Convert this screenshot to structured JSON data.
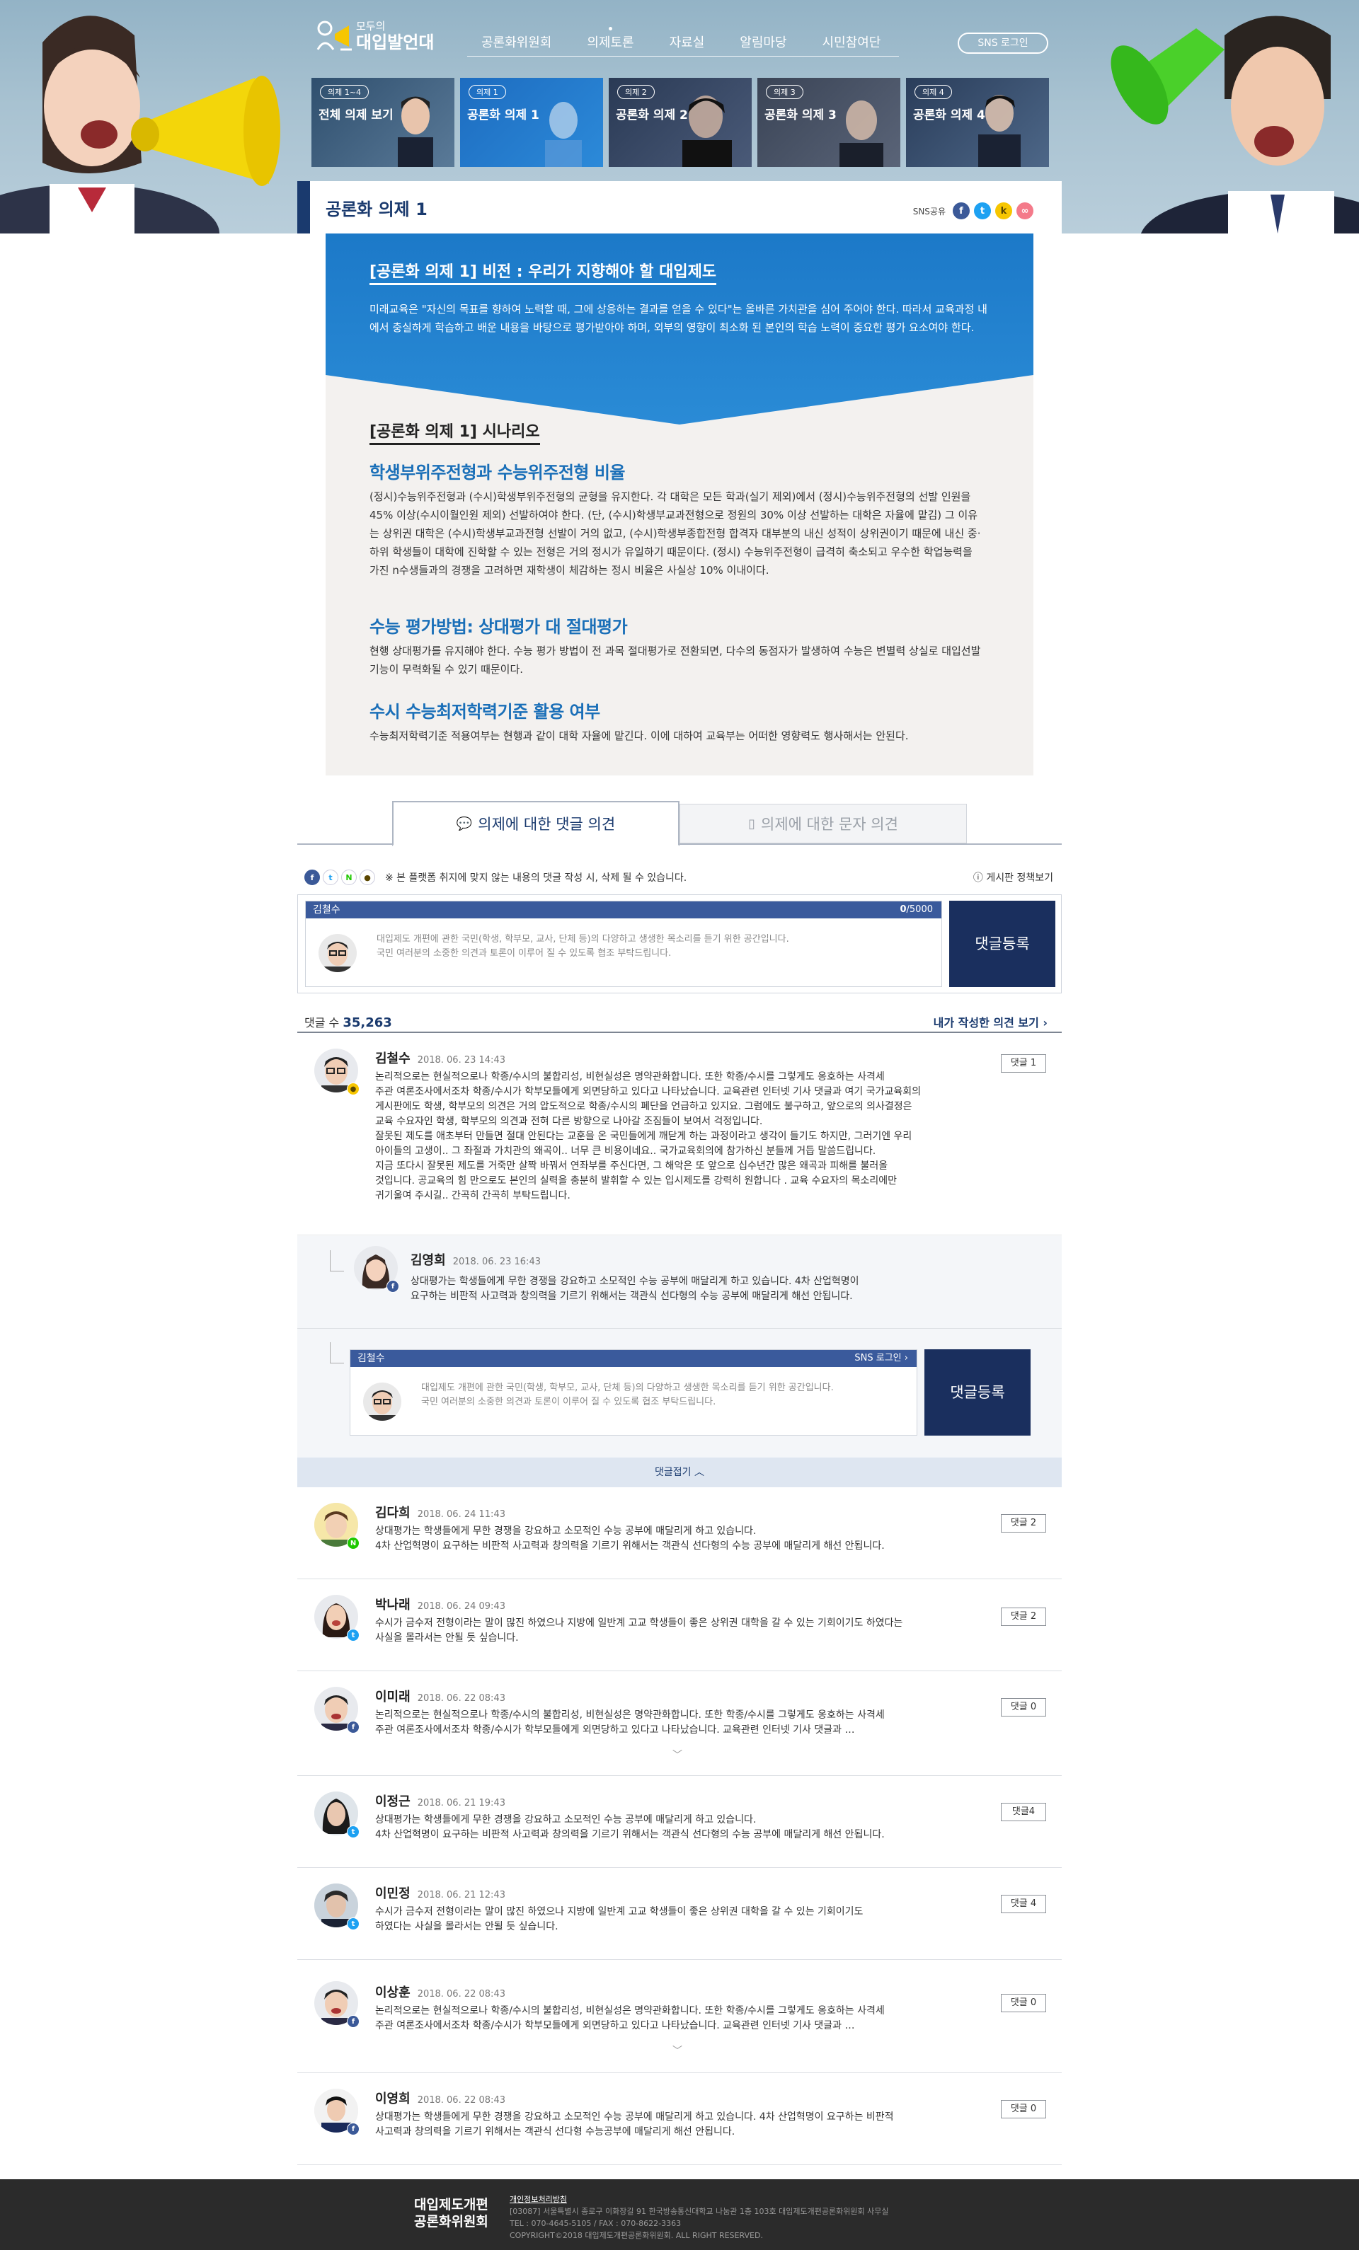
{
  "header": {
    "logo_small": "모두의",
    "logo_big": "대입발언대",
    "nav": [
      "공론화위원회",
      "의제토론",
      "자료실",
      "알림마당",
      "시민참여단"
    ],
    "sns_login": "SNS 로그인"
  },
  "topic_tabs": [
    {
      "tag": "의제 1~4",
      "name": "전체 의제 보기"
    },
    {
      "tag": "의제 1",
      "name": "공론화 의제 1"
    },
    {
      "tag": "의제 2",
      "name": "공론화 의제 2"
    },
    {
      "tag": "의제 3",
      "name": "공론화 의제 3"
    },
    {
      "tag": "의제 4",
      "name": "공론화 의제 4"
    }
  ],
  "page": {
    "title": "공론화 의제 1",
    "share_label": "SNS공유"
  },
  "vision": {
    "title": "[공론화 의제 1] 비전 : 우리가 지향해야 할 대입제도",
    "text": "미래교육은 \"자신의 목표를 향하여 노력할 때, 그에 상응하는 결과를 얻을 수 있다\"는 올바른 가치관을 심어 주어야 한다. 따라서 교육과정 내에서 충실하게 학습하고 배운 내용을 바탕으로 평가받아야 하며, 외부의 영향이 최소화 된 본인의 학습 노력이 중요한 평가 요소여야 한다."
  },
  "scenario": {
    "title": "[공론화 의제 1] 시나리오",
    "sections": [
      {
        "heading": "학생부위주전형과 수능위주전형 비율",
        "text": "(정시)수능위주전형과 (수시)학생부위주전형의 균형을 유지한다. 각 대학은 모든 학과(실기 제외)에서 (정시)수능위주전형의 선발 인원을 45% 이상(수시이월인원 제외) 선발하여야 한다. (단, (수시)학생부교과전형으로 정원의 30% 이상 선발하는 대학은 자율에 맡김) 그 이유는 상위권 대학은 (수시)학생부교과전형 선발이 거의 없고, (수시)학생부종합전형 합격자 대부분의 내신 성적이 상위권이기 때문에 내신 중·하위 학생들이 대학에 진학할 수 있는 전형은 거의 정시가 유일하기 때문이다. (정시) 수능위주전형이 급격히 축소되고 우수한 학업능력을 가진 n수생들과의 경쟁을 고려하면 재학생이 체감하는 정시 비율은 사실상 10% 이내이다."
      },
      {
        "heading": "수능 평가방법: 상대평가 대 절대평가",
        "text": "현행 상대평가를 유지해야 한다. 수능 평가 방법이 전 과목 절대평가로 전환되면, 다수의 동점자가 발생하여 수능은 변별력 상실로 대입선발 기능이 무력화될 수 있기 때문이다."
      },
      {
        "heading": "수시 수능최저학력기준 활용 여부",
        "text": "수능최저학력기준 적용여부는 현행과 같이 대학 자율에 맡긴다. 이에 대하여 교육부는 어떠한 영향력도 행사해서는 안된다."
      }
    ]
  },
  "opinion_tabs": {
    "comments": "의제에 대한 댓글 의견",
    "sms": "의제에 대한 문자 의견"
  },
  "notice": {
    "text": "※ 본 플랫폼 취지에 맞지 않는 내용의 댓글 작성 시, 삭제 될 수 있습니다.",
    "policy": "게시판 정책보기"
  },
  "write": {
    "user": "김철수",
    "count_current": "0",
    "count_max": "/5000",
    "placeholder_line1": "대입제도 개편에 관한 국민(학생, 학부모, 교사, 단체 등)의 다양하고 생생한 목소리를 듣기 위한 공간입니다.",
    "placeholder_line2": "국민 여러분의 소중한 의견과 토론이 이루어 질 수 있도록 협조 부탁드립니다.",
    "submit": "댓글등록",
    "sns_login": "SNS 로그인"
  },
  "comment_count": {
    "label": "댓글 수",
    "value": "35,263",
    "my_link": "내가 작성한 의견 보기"
  },
  "fold_label": "댓글접기",
  "comments": [
    {
      "author": "김철수",
      "date": "2018. 06. 23 14:43",
      "reply": "댓글 1",
      "badge": "kakao",
      "lines": [
        "논리적으로는 현실적으로나 학종/수시의 불합리성, 비현실성은 명약관화합니다. 또한 학종/수시를 그렇게도 옹호하는 사격세",
        "주관 여론조사에서조차 학종/수시가 학부모들에게 외면당하고 있다고 나타났습니다. 교육관련 인터넷 기사 댓글과 여기 국가교육회의",
        "게시판에도 학생, 학부모의 의견은 거의 압도적으로 학종/수시의 폐단을 언급하고 있지요. 그럼에도 불구하고, 앞으로의 의사결정은",
        "교육 수요자인 학생, 학부모의 의견과 전혀 다른 방향으로 나아갈 조짐들이 보여서 걱정입니다.",
        "잘못된 제도를 애초부터 만들면 절대 안된다는 교훈을 온 국민들에게 깨닫게 하는 과정이라고 생각이 들기도 하지만, 그러기엔 우리",
        "아이들의 고생이.. 그 좌절과 가치관의 왜곡이.. 너무 큰 비용이네요.. 국가교육회의에 참가하신 분들께 거듭 말씀드립니다.",
        "지금 또다시 잘못된 제도를 거죽만 살짝 바꿔서 연좌부를 주신다면, 그 해악은 또 앞으로 십수년간 많은 왜곡과 피해를 불러올",
        "것입니다. 공교육의 힘 만으로도 본인의 실력을 충분히 발휘할 수 있는 입시제도를 강력히 원합니다 . 교육 수요자의 목소리에만",
        "귀기울여 주시길.. 간곡히 간곡히 부탁드립니다."
      ]
    },
    {
      "author": "김영희",
      "date": "2018. 06. 23 16:43",
      "badge": "facebook",
      "lines": [
        "상대평가는 학생들에게 무한 경쟁을 강요하고 소모적인 수능 공부에 매달리게 하고 있습니다. 4차 산업혁명이",
        "요구하는 비판적 사고력과 창의력을 기르기 위해서는 객관식 선다형의 수능 공부에 매달리게 해선 안됩니다."
      ]
    },
    {
      "author": "김다희",
      "date": "2018. 06. 24 11:43",
      "reply": "댓글 2",
      "badge": "naver",
      "lines": [
        "상대평가는 학생들에게 무한 경쟁을 강요하고 소모적인 수능 공부에 매달리게 하고 있습니다.",
        "4차 산업혁명이 요구하는 비판적 사고력과 창의력을 기르기 위해서는 객관식 선다형의 수능 공부에 매달리게 해선 안됩니다."
      ]
    },
    {
      "author": "박나래",
      "date": "2018. 06. 24 09:43",
      "reply": "댓글 2",
      "badge": "twitter",
      "lines": [
        "수시가 금수저 전형이라는 말이 많진 하였으나 지방에 일반계 고교 학생들이 좋은 상위권 대학을 갈 수 있는 기회이기도 하였다는",
        "사실을 몰라서는 안될 듯 싶습니다."
      ]
    },
    {
      "author": "이미래",
      "date": "2018. 06. 22 08:43",
      "reply": "댓글 0",
      "badge": "facebook",
      "lines": [
        "논리적으로는 현실적으로나 학종/수시의 불합리성, 비현실성은 명약관화합니다. 또한 학종/수시를 그렇게도 옹호하는 사격세",
        "주관 여론조사에서조차 학종/수시가 학부모들에게 외면당하고 있다고 나타났습니다. 교육관련 인터넷 기사 댓글과 …"
      ]
    },
    {
      "author": "이정근",
      "date": "2018. 06. 21 19:43",
      "reply": "댓글4",
      "badge": "twitter",
      "lines": [
        "상대평가는 학생들에게 무한 경쟁을 강요하고 소모적인 수능 공부에 매달리게 하고 있습니다.",
        "4차 산업혁명이 요구하는 비판적 사고력과 창의력을 기르기 위해서는 객관식 선다형의 수능 공부에 매달리게 해선 안됩니다."
      ]
    },
    {
      "author": "이민정",
      "date": "2018. 06. 21 12:43",
      "reply": "댓글 4",
      "badge": "twitter",
      "lines": [
        "수시가 금수저 전형이라는 말이 많진 하였으나 지방에 일반계 고교 학생들이 좋은 상위권 대학을 갈 수 있는 기회이기도",
        "하였다는 사실을 몰라서는 안될 듯 싶습니다."
      ]
    },
    {
      "author": "이상훈",
      "date": "2018. 06. 22 08:43",
      "reply": "댓글 0",
      "badge": "facebook",
      "lines": [
        "논리적으로는 현실적으로나 학종/수시의 불합리성, 비현실성은 명약관화합니다. 또한 학종/수시를 그렇게도 옹호하는 사격세",
        "주관 여론조사에서조차 학종/수시가 학부모들에게 외면당하고 있다고 나타났습니다. 교육관련 인터넷 기사 댓글과 …"
      ]
    },
    {
      "author": "이영희",
      "date": "2018. 06. 22 08:43",
      "reply": "댓글 0",
      "badge": "facebook",
      "lines": [
        "상대평가는 학생들에게 무한 경쟁을 강요하고 소모적인 수능 공부에 매달리게 하고 있습니다. 4차 산업혁명이 요구하는 비판적",
        "사고력과 창의력을 기르기 위해서는 객관식 선다형 수능공부에 매달리게 해선 안됩니다."
      ]
    }
  ],
  "footer": {
    "logo_line1": "대입제도개편",
    "logo_line2": "공론화위원회",
    "privacy": "개인정보처리방침",
    "address": "[03087] 서울특별시 종로구 이화장길 91 한국방송통신대학교 나눔관 1층 103호 대입제도개편공론화위원회 사무실",
    "tel": "TEL : 070-4645-5105 / FAX : 070-8622-3363",
    "copyright": "COPYRIGHT©2018 대입제도개편공론화위원회. ALL RIGHT RESERVED."
  },
  "colors": {
    "navy": "#1a3a6e",
    "accent_blue": "#1a6fb8",
    "vision_blue": "#1f7fcf",
    "facebook": "#3b5998",
    "twitter": "#1da1f2",
    "kakao": "#f7c600",
    "naver": "#1ec800"
  }
}
